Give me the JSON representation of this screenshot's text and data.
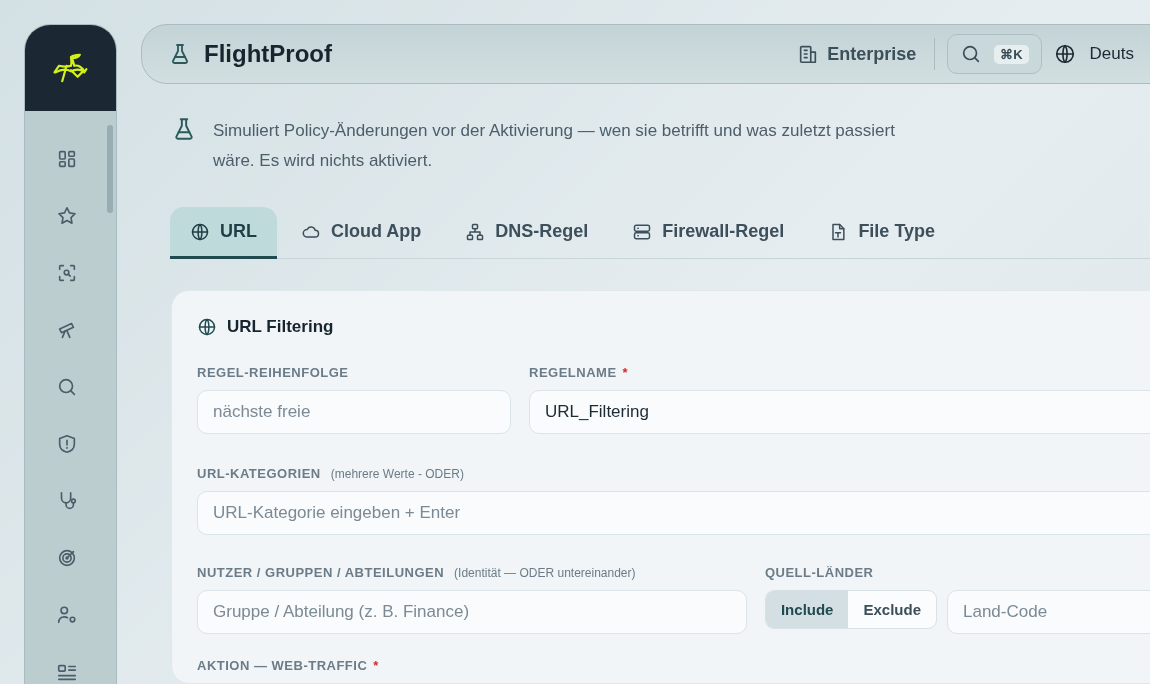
{
  "sidebar": {
    "items": [
      {
        "kind": "dashboard"
      },
      {
        "kind": "star"
      },
      {
        "kind": "scan"
      },
      {
        "kind": "telescope"
      },
      {
        "kind": "search"
      },
      {
        "kind": "shield"
      },
      {
        "kind": "stethoscope"
      },
      {
        "kind": "radar"
      },
      {
        "kind": "user-settings"
      },
      {
        "kind": "list"
      }
    ]
  },
  "header": {
    "title": "FlightProof",
    "edition": "Enterprise",
    "shortcut": "⌘K",
    "language": "Deuts"
  },
  "intro": "Simuliert Policy-Änderungen vor der Aktivierung — wen sie betrifft und was zuletzt passiert wäre. Es wird nichts aktiviert.",
  "tabs": [
    {
      "label": "URL",
      "kind": "globe",
      "selected": true
    },
    {
      "label": "Cloud App",
      "kind": "cloud",
      "selected": false
    },
    {
      "label": "DNS-Regel",
      "kind": "network",
      "selected": false
    },
    {
      "label": "Firewall-Regel",
      "kind": "server",
      "selected": false
    },
    {
      "label": "File Type",
      "kind": "file",
      "selected": false
    }
  ],
  "card": {
    "title": "URL Filtering",
    "order": {
      "label": "REGEL-REIHENFOLGE",
      "placeholder": "nächste freie"
    },
    "name": {
      "label": "REGELNAME",
      "marker": "*",
      "value": "URL_Filtering"
    },
    "categories": {
      "label": "URL-KATEGORIEN",
      "hint": "(mehrere Werte - ODER)",
      "placeholder": "URL-Kategorie eingeben + Enter"
    },
    "users": {
      "label": "NUTZER / GRUPPEN / ABTEILUNGEN",
      "hint": "(Identität — ODER untereinander)",
      "placeholder": "Gruppe / Abteilung (z. B. Finance)"
    },
    "countries": {
      "label": "QUELL-LÄNDER",
      "options": [
        {
          "label": "Include",
          "selected": true
        },
        {
          "label": "Exclude",
          "selected": false
        }
      ],
      "placeholder": "Land-Code"
    },
    "action": {
      "label": "AKTION — WEB-TRAFFIC",
      "marker": "*"
    }
  }
}
